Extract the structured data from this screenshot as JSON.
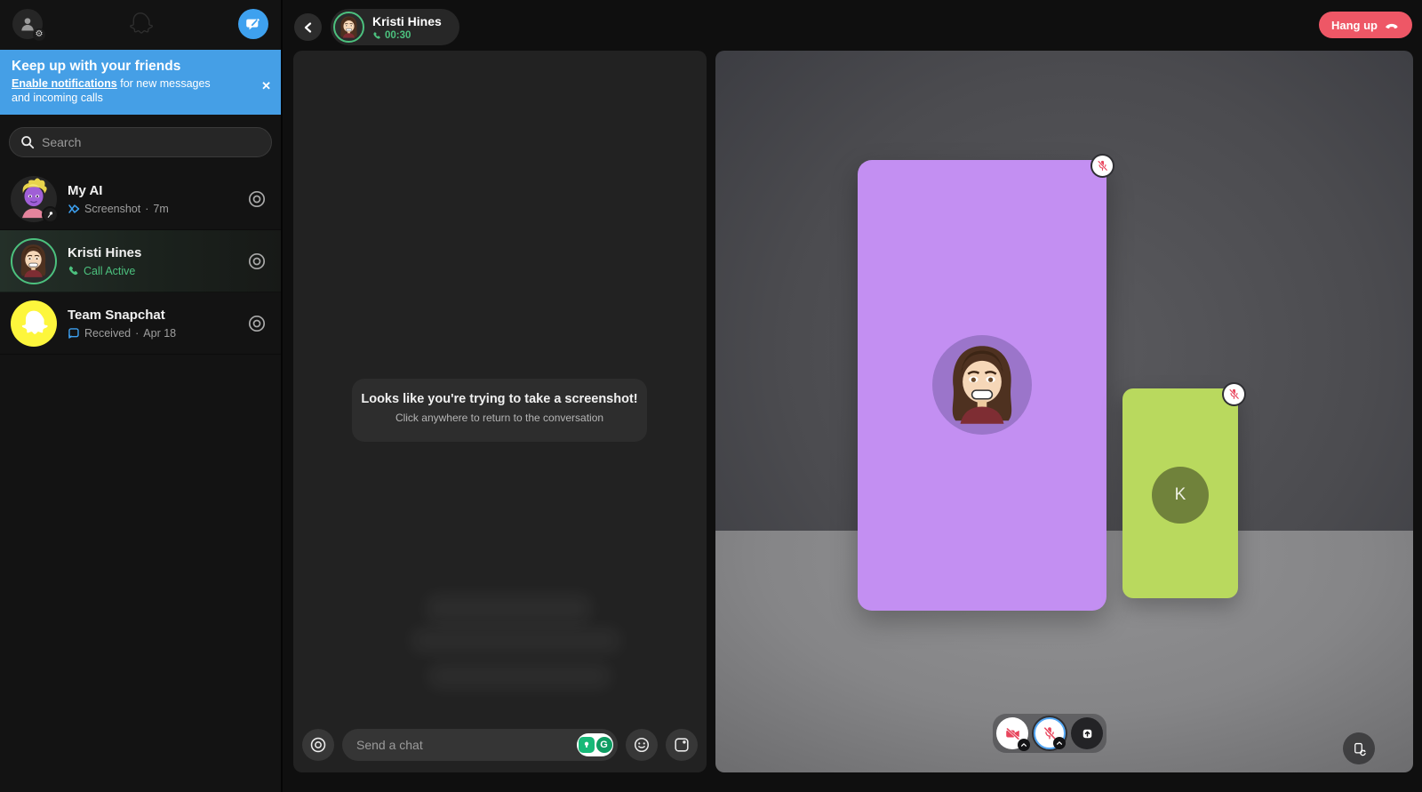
{
  "banner": {
    "title": "Keep up with your friends",
    "link": "Enable notifications",
    "rest": " for new messages",
    "line2": "and incoming calls",
    "close": "✕"
  },
  "search": {
    "placeholder": "Search"
  },
  "conversations": [
    {
      "name": "My AI",
      "status": "Screenshot",
      "sep": "·",
      "time": "7m"
    },
    {
      "name": "Kristi Hines",
      "status": "Call Active"
    },
    {
      "name": "Team Snapchat",
      "status": "Received",
      "sep": "·",
      "time": "Apr 18"
    }
  ],
  "chat": {
    "header": {
      "name": "Kristi Hines",
      "timer": "00:30"
    },
    "overlay": {
      "title": "Looks like you're trying to take a screenshot!",
      "subtitle": "Click anywhere to return to the conversation"
    },
    "input": {
      "placeholder": "Send a chat"
    }
  },
  "call": {
    "hang_up": "Hang up",
    "remote_initial": "K"
  },
  "extensions": {
    "grammarly_letter": "G"
  },
  "colors": {
    "accent_blue": "#3ea1ef",
    "banner_blue": "#459fe6",
    "active_green": "#4cc17e",
    "mute_red": "#e8455c",
    "hangup_red": "#ee5766",
    "purple_card": "#c38ff2",
    "green_card": "#b9d95e",
    "snap_yellow": "#fdf63c"
  }
}
